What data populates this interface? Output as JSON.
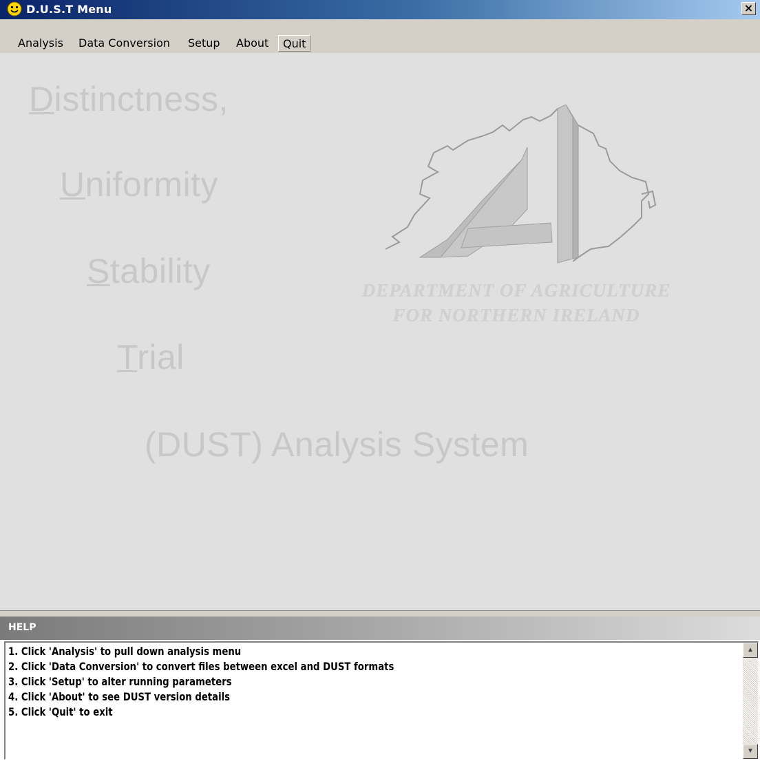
{
  "window": {
    "title": "D.U.S.T Menu",
    "close_glyph": "×",
    "icon": "smiley-icon"
  },
  "menu": {
    "items": [
      "Analysis",
      "Data Conversion",
      "Setup",
      "About",
      "Quit"
    ]
  },
  "splash": {
    "line1_first": "D",
    "line1_rest": "istinctness,",
    "line2_first": "U",
    "line2_rest": "niformity",
    "line3_first": "S",
    "line3_rest": "tability",
    "line4_first": "T",
    "line4_rest": "rial",
    "line5": "(DUST) Analysis System",
    "dept_line1": "DEPARTMENT OF AGRICULTURE",
    "dept_line2": "FOR NORTHERN IRELAND"
  },
  "help": {
    "title": "HELP",
    "lines": [
      "1. Click 'Analysis' to pull down analysis menu",
      "2. Click 'Data Conversion' to convert files between excel and DUST formats",
      "3. Click 'Setup' to alter running parameters",
      "4. Click 'About' to see DUST version details",
      "5. Click 'Quit' to exit"
    ]
  }
}
